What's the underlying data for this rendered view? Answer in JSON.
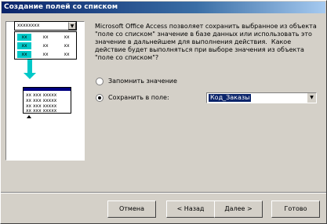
{
  "window": {
    "title": "Создание полей со списком"
  },
  "illustration": {
    "combo_text": "xxxxxxxx",
    "grid": [
      "xx",
      "xx",
      "xx",
      "xx",
      "xx",
      "xx",
      "xx",
      "xx",
      "xx"
    ],
    "field_rows": [
      "xx xxx xxxxx",
      "xx xxx xxxxx",
      "xx xxx xxxxx",
      "xx xxx xxxxx"
    ]
  },
  "description": "Microsoft Office Access позволяет сохранить выбранное из объекта \"поле со списком\" значение в базе данных или использовать это значение в дальнейшем для выполнения действия.  Какое действие будет выполняться при выборе значения из объекта \"поле со списком\"?",
  "options": [
    {
      "label": "Запомнить значение",
      "selected": false
    },
    {
      "label": "Сохранить в поле:",
      "selected": true
    }
  ],
  "field_select": {
    "value": "Код_Заказы"
  },
  "buttons": {
    "cancel": "Отмена",
    "back": "< Назад",
    "next": "Далее >",
    "finish": "Готово"
  }
}
